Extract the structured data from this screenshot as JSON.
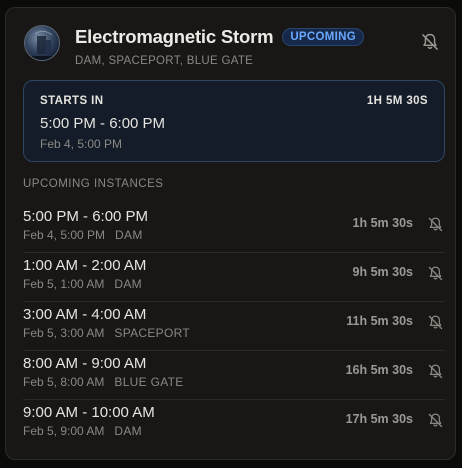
{
  "event": {
    "title": "Electromagnetic Storm",
    "status_badge": "UPCOMING",
    "locations": "DAM, SPACEPORT, BLUE GATE",
    "avatar_icon": "storm-avatar",
    "notify_icon": "bell-off-icon"
  },
  "starts_in": {
    "label": "STARTS IN",
    "countdown": "1H 5M 30S",
    "time_range": "5:00 PM - 6:00 PM",
    "date": "Feb 4, 5:00 PM"
  },
  "upcoming": {
    "title": "UPCOMING INSTANCES",
    "instances": [
      {
        "time_range": "5:00 PM - 6:00 PM",
        "date": "Feb 4, 5:00 PM",
        "location": "DAM",
        "countdown": "1h 5m 30s"
      },
      {
        "time_range": "1:00 AM - 2:00 AM",
        "date": "Feb 5, 1:00 AM",
        "location": "DAM",
        "countdown": "9h 5m 30s"
      },
      {
        "time_range": "3:00 AM - 4:00 AM",
        "date": "Feb 5, 3:00 AM",
        "location": "SPACEPORT",
        "countdown": "11h 5m 30s"
      },
      {
        "time_range": "8:00 AM - 9:00 AM",
        "date": "Feb 5, 8:00 AM",
        "location": "BLUE GATE",
        "countdown": "16h 5m 30s"
      },
      {
        "time_range": "9:00 AM - 10:00 AM",
        "date": "Feb 5, 9:00 AM",
        "location": "DAM",
        "countdown": "17h 5m 30s"
      }
    ]
  },
  "colors": {
    "accent_blue": "#6aa8ff",
    "card_bg": "#181715",
    "starts_box_bg": "#131c28",
    "starts_box_border": "#2d4463"
  }
}
